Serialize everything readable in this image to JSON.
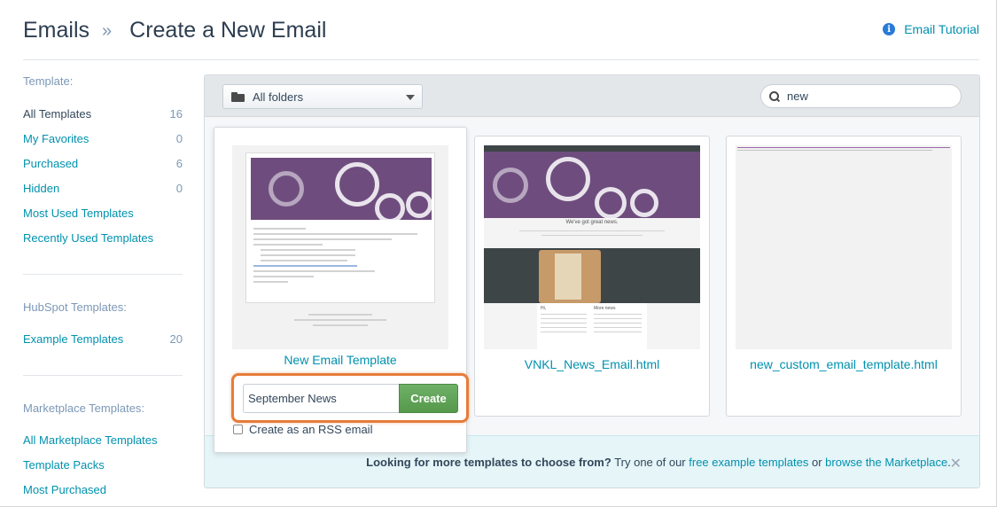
{
  "header": {
    "breadcrumb_root": "Emails",
    "breadcrumb_sep": "»",
    "title": "Create a New Email",
    "tutorial_label": "Email Tutorial"
  },
  "sidebar": {
    "template_section": "Template:",
    "template_items": [
      {
        "label": "All Templates",
        "count": "16"
      },
      {
        "label": "My Favorites",
        "count": "0"
      },
      {
        "label": "Purchased",
        "count": "6"
      },
      {
        "label": "Hidden",
        "count": "0"
      },
      {
        "label": "Most Used Templates",
        "count": ""
      },
      {
        "label": "Recently Used Templates",
        "count": ""
      }
    ],
    "hubspot_section": "HubSpot Templates:",
    "hubspot_items": [
      {
        "label": "Example Templates",
        "count": "20"
      }
    ],
    "marketplace_section": "Marketplace Templates:",
    "marketplace_items": [
      {
        "label": "All Marketplace Templates"
      },
      {
        "label": "Template Packs"
      },
      {
        "label": "Most Purchased"
      }
    ]
  },
  "toolbar": {
    "folder_value": "All folders",
    "search_value": "new"
  },
  "cards": [
    {
      "name": "New Email Template"
    },
    {
      "name": "VNKL_News_Email.html",
      "mock_heading": "We've got great news.",
      "mock_col1": "Hi,",
      "mock_col2": "More news"
    },
    {
      "name": "new_custom_email_template.html"
    }
  ],
  "create": {
    "input_value": "September News",
    "button_label": "Create",
    "rss_label": "Create as an RSS email",
    "rss_checked": false
  },
  "info_strip": {
    "lead": "Looking for more templates to choose from?",
    "try_text": " Try one of our ",
    "link1": "free example templates",
    "or_text": " or ",
    "link2": "browse the Marketplace",
    "period": ".",
    "close_symbol": "✕"
  },
  "colors": {
    "accent_link": "#0091ae",
    "create_green": "#5ea355",
    "highlight_orange": "#e67c3a",
    "template_purple": "#6e4d7e"
  }
}
